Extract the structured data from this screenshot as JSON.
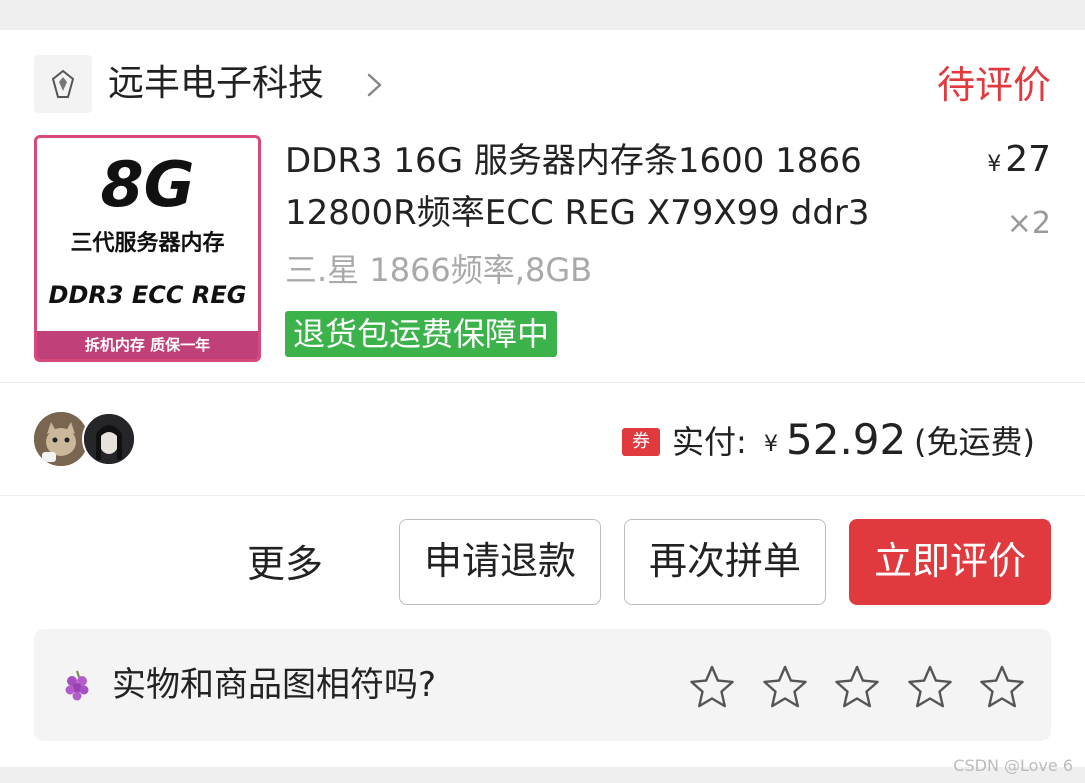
{
  "shop": {
    "name": "远丰电子科技",
    "status": "待评价"
  },
  "product": {
    "image": {
      "big_text": "8G",
      "mid_text": "三代服务器内存",
      "spec_text": "DDR3  ECC REG",
      "band_text": "拆机内存  质保一年"
    },
    "title": "DDR3 16G 服务器内存条1600 1866 12800R频率ECC REG X79X99 ddr3",
    "sku": "三.星 1866频率,8GB",
    "guarantee_tag": "退货包运费保障中",
    "price_currency": "¥",
    "price": "27",
    "quantity": "×2"
  },
  "payment": {
    "coupon_icon": "券",
    "paid_label": "实付:",
    "currency": "¥",
    "amount": "52.92",
    "shipping_note": "(免运费)"
  },
  "actions": {
    "more": "更多",
    "refund": "申请退款",
    "reorder": "再次拼单",
    "review": "立即评价"
  },
  "feedback": {
    "question": "实物和商品图相符吗?",
    "stars": 5
  },
  "watermark": "CSDN @Love 6",
  "colors": {
    "accent_red": "#e0393e",
    "guarantee_green": "#3cb34a",
    "muted_gray": "#a9a9a9"
  }
}
